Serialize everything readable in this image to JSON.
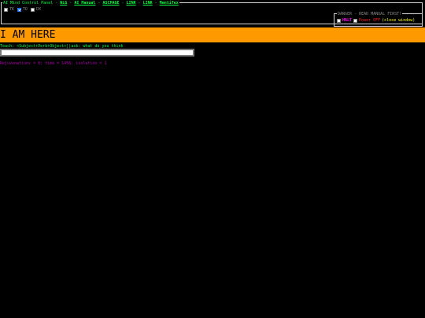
{
  "panel": {
    "title": "AI Mind Control Panel",
    "separator": " - ",
    "links": [
      {
        "label": "NLG"
      },
      {
        "label": "AI Manual"
      },
      {
        "label": "ASCPAGE"
      },
      {
        "label": "LINK"
      },
      {
        "label": "LINK"
      },
      {
        "label": "Mentifex"
      }
    ],
    "checkboxes": [
      {
        "label": "TK",
        "checked": false
      },
      {
        "label": "TD",
        "checked": true
      },
      {
        "label": "DX",
        "checked": false
      }
    ]
  },
  "danger": {
    "legend": "DANGER - READ MANUAL FIRST!",
    "halt_label": "HALT",
    "power_label": "Power OFF",
    "close_label": "(close window)"
  },
  "banner": {
    "text": "I AM HERE",
    "color": "#ff9900"
  },
  "teach": {
    "label": "Teach: <Subject+Verb+Object>||ask: what do you think",
    "value": "",
    "placeholder": ""
  },
  "status": {
    "text": "Rejuvenations = 0; time = 1456; isolation = 1"
  },
  "colors": {
    "accent_green": "#00ff40",
    "magenta": "#b000b0",
    "halt": "#ff00ff",
    "power": "#ff2020",
    "close": "#ffff00"
  }
}
